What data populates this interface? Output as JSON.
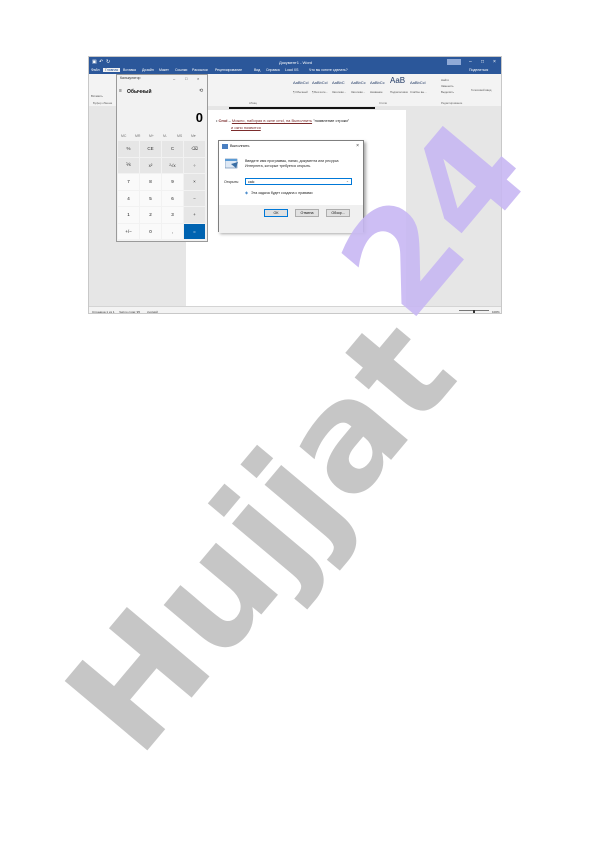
{
  "word": {
    "title": "Документ1 - Word",
    "account": "",
    "menu": [
      "Файл",
      "Главная",
      "Вставка",
      "Дизайн",
      "Макет",
      "Ссылки",
      "Рассылки",
      "Рецензирование",
      "Вид",
      "Справка",
      "Load XS",
      "Что вы хотите сделать?"
    ],
    "share": "Поделиться",
    "ribbon": {
      "paste": "Вставить",
      "clipboard": "Буфер обмена",
      "styles": [
        "AaBbCcl",
        "AaBbCcl",
        "AaBbC",
        "AaBbCc",
        "AaBbCc",
        "AaB",
        "AaBbCcl"
      ],
      "style_names": [
        "¶ Обычный",
        "¶ Без инте...",
        "Заголово...",
        "Заголово...",
        "Название",
        "Подзаголовок",
        "Слабое вы..."
      ],
      "paragraph": "Абзац",
      "styles_label": "Стили",
      "find": "Найти",
      "replace": "Заменить",
      "select": "Выделить",
      "editing": "Редактирование",
      "addin": "Голосовой ввод"
    },
    "document": {
      "bullet_bold": "Cmd",
      "bullet_link": "Можно, набирая в окне cmd, на Выполнить",
      "bullet_rest": "появление строки",
      "bullet_line2": "и окно появится"
    },
    "status": {
      "page": "Страница 1 из 1",
      "words": "Число слов: 95",
      "lang": "русский",
      "zoom": "100%"
    }
  },
  "calculator": {
    "title": "Калькулятор",
    "mode": "Обычный",
    "display": "0",
    "memory": [
      "MC",
      "MR",
      "M+",
      "M-",
      "MS",
      "M▾"
    ],
    "keys": [
      [
        "%",
        "CE",
        "C",
        "⌫"
      ],
      [
        "⅟x",
        "x²",
        "²√x",
        "÷"
      ],
      [
        "7",
        "8",
        "9",
        "×"
      ],
      [
        "4",
        "5",
        "6",
        "−"
      ],
      [
        "1",
        "2",
        "3",
        "+"
      ],
      [
        "+/−",
        "0",
        ",",
        "="
      ]
    ]
  },
  "run_dialog": {
    "title": "Выполнить",
    "description": "Введите имя программы, папки, документа или ресурса Интернета, которые требуется открыть.",
    "open_label": "Открыть:",
    "input_value": "calc",
    "admin_note": "Эта задача будет создана с правами",
    "ok": "ОК",
    "cancel": "Отмена",
    "browse": "Обзор..."
  },
  "watermark": {
    "text1": "Hujjat",
    "text2": "24"
  },
  "colors": {
    "word_blue": "#2b579a",
    "calc_equals": "#0063b1",
    "watermark_gray": "#c0c0c0",
    "watermark_purple": "#c8b8f3"
  }
}
